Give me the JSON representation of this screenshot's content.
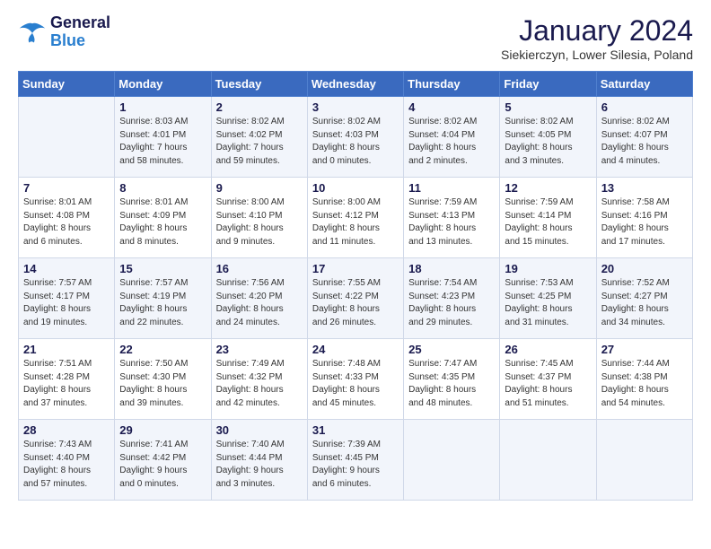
{
  "logo": {
    "line1": "General",
    "line2": "Blue"
  },
  "header": {
    "title": "January 2024",
    "subtitle": "Siekierczyn, Lower Silesia, Poland"
  },
  "weekdays": [
    "Sunday",
    "Monday",
    "Tuesday",
    "Wednesday",
    "Thursday",
    "Friday",
    "Saturday"
  ],
  "weeks": [
    [
      {
        "day": "",
        "info": ""
      },
      {
        "day": "1",
        "info": "Sunrise: 8:03 AM\nSunset: 4:01 PM\nDaylight: 7 hours\nand 58 minutes."
      },
      {
        "day": "2",
        "info": "Sunrise: 8:02 AM\nSunset: 4:02 PM\nDaylight: 7 hours\nand 59 minutes."
      },
      {
        "day": "3",
        "info": "Sunrise: 8:02 AM\nSunset: 4:03 PM\nDaylight: 8 hours\nand 0 minutes."
      },
      {
        "day": "4",
        "info": "Sunrise: 8:02 AM\nSunset: 4:04 PM\nDaylight: 8 hours\nand 2 minutes."
      },
      {
        "day": "5",
        "info": "Sunrise: 8:02 AM\nSunset: 4:05 PM\nDaylight: 8 hours\nand 3 minutes."
      },
      {
        "day": "6",
        "info": "Sunrise: 8:02 AM\nSunset: 4:07 PM\nDaylight: 8 hours\nand 4 minutes."
      }
    ],
    [
      {
        "day": "7",
        "info": "Sunrise: 8:01 AM\nSunset: 4:08 PM\nDaylight: 8 hours\nand 6 minutes."
      },
      {
        "day": "8",
        "info": "Sunrise: 8:01 AM\nSunset: 4:09 PM\nDaylight: 8 hours\nand 8 minutes."
      },
      {
        "day": "9",
        "info": "Sunrise: 8:00 AM\nSunset: 4:10 PM\nDaylight: 8 hours\nand 9 minutes."
      },
      {
        "day": "10",
        "info": "Sunrise: 8:00 AM\nSunset: 4:12 PM\nDaylight: 8 hours\nand 11 minutes."
      },
      {
        "day": "11",
        "info": "Sunrise: 7:59 AM\nSunset: 4:13 PM\nDaylight: 8 hours\nand 13 minutes."
      },
      {
        "day": "12",
        "info": "Sunrise: 7:59 AM\nSunset: 4:14 PM\nDaylight: 8 hours\nand 15 minutes."
      },
      {
        "day": "13",
        "info": "Sunrise: 7:58 AM\nSunset: 4:16 PM\nDaylight: 8 hours\nand 17 minutes."
      }
    ],
    [
      {
        "day": "14",
        "info": "Sunrise: 7:57 AM\nSunset: 4:17 PM\nDaylight: 8 hours\nand 19 minutes."
      },
      {
        "day": "15",
        "info": "Sunrise: 7:57 AM\nSunset: 4:19 PM\nDaylight: 8 hours\nand 22 minutes."
      },
      {
        "day": "16",
        "info": "Sunrise: 7:56 AM\nSunset: 4:20 PM\nDaylight: 8 hours\nand 24 minutes."
      },
      {
        "day": "17",
        "info": "Sunrise: 7:55 AM\nSunset: 4:22 PM\nDaylight: 8 hours\nand 26 minutes."
      },
      {
        "day": "18",
        "info": "Sunrise: 7:54 AM\nSunset: 4:23 PM\nDaylight: 8 hours\nand 29 minutes."
      },
      {
        "day": "19",
        "info": "Sunrise: 7:53 AM\nSunset: 4:25 PM\nDaylight: 8 hours\nand 31 minutes."
      },
      {
        "day": "20",
        "info": "Sunrise: 7:52 AM\nSunset: 4:27 PM\nDaylight: 8 hours\nand 34 minutes."
      }
    ],
    [
      {
        "day": "21",
        "info": "Sunrise: 7:51 AM\nSunset: 4:28 PM\nDaylight: 8 hours\nand 37 minutes."
      },
      {
        "day": "22",
        "info": "Sunrise: 7:50 AM\nSunset: 4:30 PM\nDaylight: 8 hours\nand 39 minutes."
      },
      {
        "day": "23",
        "info": "Sunrise: 7:49 AM\nSunset: 4:32 PM\nDaylight: 8 hours\nand 42 minutes."
      },
      {
        "day": "24",
        "info": "Sunrise: 7:48 AM\nSunset: 4:33 PM\nDaylight: 8 hours\nand 45 minutes."
      },
      {
        "day": "25",
        "info": "Sunrise: 7:47 AM\nSunset: 4:35 PM\nDaylight: 8 hours\nand 48 minutes."
      },
      {
        "day": "26",
        "info": "Sunrise: 7:45 AM\nSunset: 4:37 PM\nDaylight: 8 hours\nand 51 minutes."
      },
      {
        "day": "27",
        "info": "Sunrise: 7:44 AM\nSunset: 4:38 PM\nDaylight: 8 hours\nand 54 minutes."
      }
    ],
    [
      {
        "day": "28",
        "info": "Sunrise: 7:43 AM\nSunset: 4:40 PM\nDaylight: 8 hours\nand 57 minutes."
      },
      {
        "day": "29",
        "info": "Sunrise: 7:41 AM\nSunset: 4:42 PM\nDaylight: 9 hours\nand 0 minutes."
      },
      {
        "day": "30",
        "info": "Sunrise: 7:40 AM\nSunset: 4:44 PM\nDaylight: 9 hours\nand 3 minutes."
      },
      {
        "day": "31",
        "info": "Sunrise: 7:39 AM\nSunset: 4:45 PM\nDaylight: 9 hours\nand 6 minutes."
      },
      {
        "day": "",
        "info": ""
      },
      {
        "day": "",
        "info": ""
      },
      {
        "day": "",
        "info": ""
      }
    ]
  ]
}
